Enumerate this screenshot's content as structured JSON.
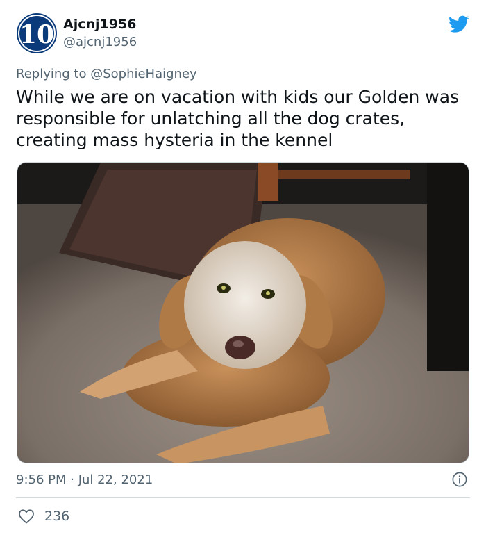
{
  "tweet": {
    "avatar_text": "10",
    "display_name": "Ajcnj1956",
    "handle": "@ajcnj1956",
    "replying_prefix": "Replying to ",
    "replying_to": "@SophieHaigney",
    "text": "While we are on vacation with kids our Golden was responsible for unlatching all the dog crates, creating mass hysteria in the kennel",
    "timestamp": "9:56 PM · Jul 22, 2021",
    "like_count": "236",
    "media_description": "golden retriever lying on carpet"
  },
  "colors": {
    "twitter_blue": "#1d9bf0",
    "avatar_blue": "#0a3a7a",
    "secondary_text": "#536471",
    "divider": "#cfd9de"
  },
  "icons": {
    "brand": "twitter-bird-icon",
    "info": "info-icon",
    "like": "heart-icon"
  }
}
